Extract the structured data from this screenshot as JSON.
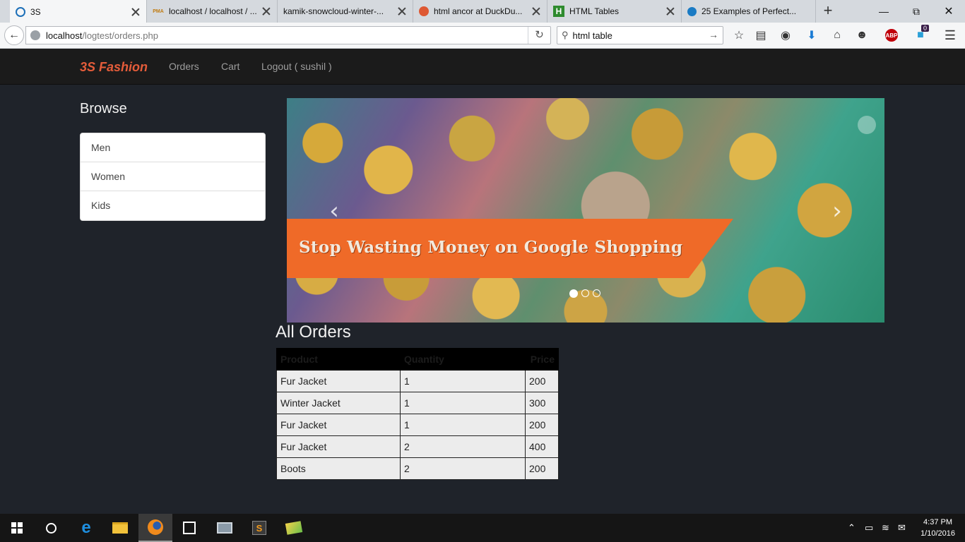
{
  "browser": {
    "tabs": [
      {
        "title": "3S",
        "favicon": "3s-icon",
        "active": true
      },
      {
        "title": "localhost / localhost / ...",
        "favicon": "pma-icon",
        "favicon_text": "PMA"
      },
      {
        "title": "kamik-snowcloud-winter-...",
        "favicon": "none"
      },
      {
        "title": "html ancor at DuckDu...",
        "favicon": "duckduckgo-icon"
      },
      {
        "title": "HTML Tables",
        "favicon": "html-h-icon",
        "favicon_text": "H"
      },
      {
        "title": "25 Examples of Perfect...",
        "favicon": "site-icon"
      }
    ],
    "url_host": "localhost",
    "url_path": "/logtest/orders.php",
    "search_value": "html table",
    "badge_count": "0",
    "abp_label": "ABP"
  },
  "site": {
    "brand": "3S Fashion",
    "nav": [
      "Orders",
      "Cart",
      "Logout ( sushil )"
    ],
    "browse_title": "Browse",
    "browse_items": [
      "Men",
      "Women",
      "Kids"
    ],
    "carousel": {
      "banner_text": "Stop Wasting Money on Google Shopping",
      "slide_count": 3,
      "active_slide": 1
    },
    "orders_title": "All Orders",
    "orders_columns": [
      "Product",
      "Quantity",
      "Price"
    ],
    "orders_rows": [
      [
        "Fur Jacket",
        "1",
        "200"
      ],
      [
        "Winter Jacket",
        "1",
        "300"
      ],
      [
        "Fur Jacket",
        "1",
        "200"
      ],
      [
        "Fur Jacket",
        "2",
        "400"
      ],
      [
        "Boots",
        "2",
        "200"
      ]
    ]
  },
  "taskbar": {
    "time": "4:37 PM",
    "date": "1/10/2016"
  },
  "colors": {
    "brand": "#e45c3a",
    "page_bg": "#1f232a",
    "banner": "#ef6a28"
  }
}
